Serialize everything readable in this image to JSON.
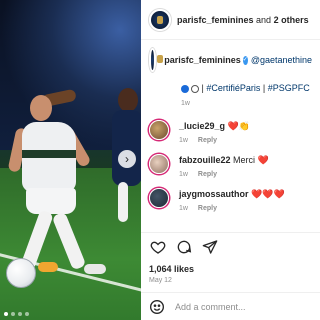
{
  "post": {
    "image_alt": "",
    "carousel_dots": 4,
    "active_dot": 0
  },
  "header": {
    "username": "parisfc_feminines",
    "connector": "and",
    "others": "2 others"
  },
  "caption": {
    "username": "parisfc_feminines",
    "verified_mark": "✓",
    "mention": "@gaetanethine",
    "separator": "|",
    "tag_certifie": "#CertifiéParis",
    "tag_psgpfc": "#PSGPFC",
    "age": "1w"
  },
  "comments": [
    {
      "username": "_lucie29_g",
      "text": "❤️👏",
      "age": "1w",
      "reply_label": "Reply"
    },
    {
      "username": "fabzouille22",
      "text": "Merci ❤️",
      "age": "1w",
      "reply_label": "Reply"
    },
    {
      "username": "jaygmossauthor",
      "text": "❤️❤️❤️",
      "age": "1w",
      "reply_label": "Reply"
    }
  ],
  "actions": {
    "icons": [
      "heart-icon",
      "comment-icon",
      "share-icon"
    ],
    "likes": "1,064 likes",
    "date": "May 12"
  },
  "composer": {
    "placeholder": "Add a comment...",
    "value": ""
  },
  "colors": {
    "link": "#00376b",
    "verified": "#3897f0",
    "heart": "#ed4956",
    "muted": "#8e8e8e"
  }
}
